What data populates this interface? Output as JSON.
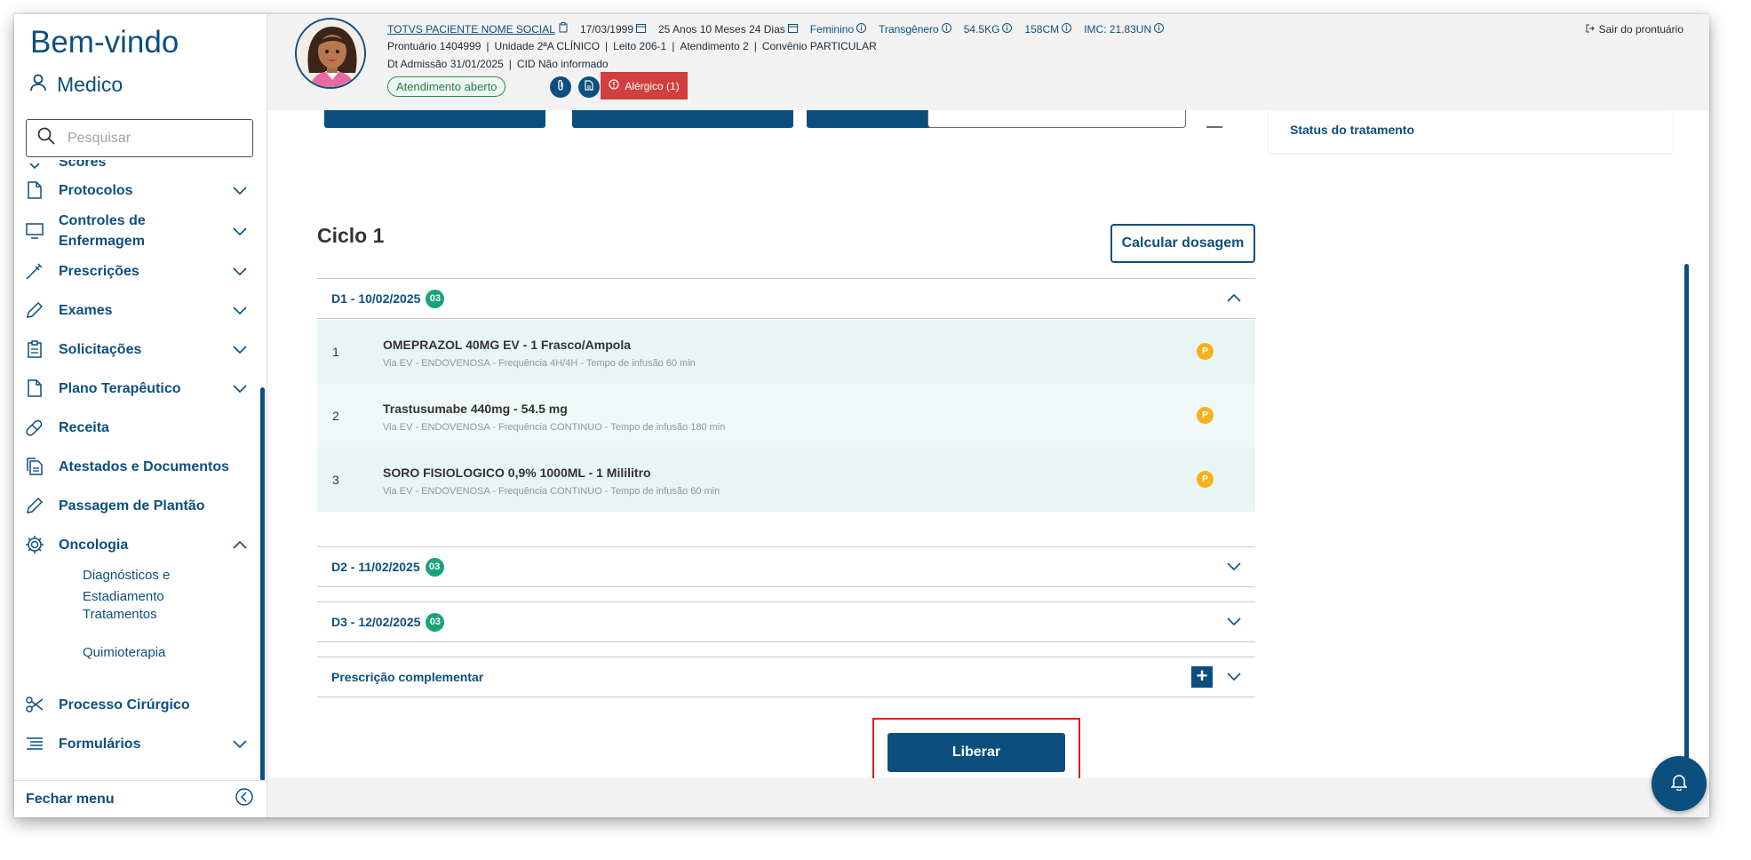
{
  "sidebar": {
    "welcome": "Bem-vindo",
    "user": "Medico",
    "search_placeholder": "Pesquisar",
    "items": [
      {
        "label": "Scores",
        "icon": "chevron-down-icon"
      },
      {
        "label": "Protocolos",
        "icon": "document-icon",
        "chevron": "down"
      },
      {
        "label": "Controles de Enfermagem",
        "icon": "monitor-icon",
        "chevron": "down"
      },
      {
        "label": "Prescrições",
        "icon": "syringe-icon",
        "chevron": "down"
      },
      {
        "label": "Exames",
        "icon": "pencil-icon",
        "chevron": "down"
      },
      {
        "label": "Solicitações",
        "icon": "clipboard-icon",
        "chevron": "down"
      },
      {
        "label": "Plano Terapêutico",
        "icon": "document-icon",
        "chevron": "down"
      },
      {
        "label": "Receita",
        "icon": "pill-icon"
      },
      {
        "label": "Atestados e Documentos",
        "icon": "documents-icon"
      },
      {
        "label": "Passagem de Plantão",
        "icon": "pencil-icon"
      },
      {
        "label": "Oncologia",
        "icon": "gear-icon",
        "chevron": "up"
      },
      {
        "label": "Processo Cirúrgico",
        "icon": "scissors-icon"
      },
      {
        "label": "Formulários",
        "icon": "list-icon",
        "chevron": "down"
      }
    ],
    "oncologia_sub": [
      "Diagnósticos e Estadiamento",
      "Tratamentos",
      "Quimioterapia"
    ],
    "close_menu": "Fechar menu"
  },
  "patient": {
    "name": "TOTVS PACIENTE NOME SOCIAL",
    "birth": "17/03/1999",
    "age": "25 Anos 10 Meses 24 Dias",
    "sex": "Feminino",
    "gender": "Transgênero",
    "weight": "54.5KG",
    "height": "158CM",
    "imc": "IMC: 21.83UN",
    "prontuario": "Prontuário 1404999",
    "unidade": "Unidade 2ªA CLÍNICO",
    "leito": "Leito 206-1",
    "atendimento": "Atendimento 2",
    "convenio": "Convênio PARTICULAR",
    "admissao": "Dt Admissão 31/01/2025",
    "cid": "CID Não informado",
    "status": "Atendimento aberto",
    "alergico": "Alérgico (1)",
    "exit": "Sair do prontuário"
  },
  "colors": {
    "primary": "#0c4f7f",
    "danger": "#d13f3f",
    "success": "#1aa37a",
    "warning": "#f5b21b",
    "row_bg": "#e9f5f5"
  },
  "main": {
    "status_title": "Status do tratamento",
    "ciclo_title": "Ciclo 1",
    "calc_button": "Calcular dosagem",
    "days": [
      {
        "label": "D1 - 10/02/2025",
        "count": "03",
        "expanded": true
      },
      {
        "label": "D2 - 11/02/2025",
        "count": "03",
        "expanded": false
      },
      {
        "label": "D3 - 12/02/2025",
        "count": "03",
        "expanded": false
      }
    ],
    "items": [
      {
        "n": "1",
        "title": "OMEPRAZOL 40MG EV - 1 Frasco/Ampola",
        "desc": "Via EV - ENDOVENOSA - Frequência 4H/4H - Tempo de infusão 60 min",
        "badge": "P"
      },
      {
        "n": "2",
        "title": "Trastusumabe 440mg - 54.5 mg",
        "desc": "Via EV - ENDOVENOSA - Frequência CONTINUO - Tempo de infusão 180 min",
        "badge": "P"
      },
      {
        "n": "3",
        "title": "SORO FISIOLOGICO 0,9% 1000ML - 1 Mililitro",
        "desc": "Via EV - ENDOVENOSA - Frequência CONTINUO - Tempo de infusão 60 min",
        "badge": "P"
      }
    ],
    "complementar": "Prescrição complementar",
    "release_button": "Liberar"
  }
}
